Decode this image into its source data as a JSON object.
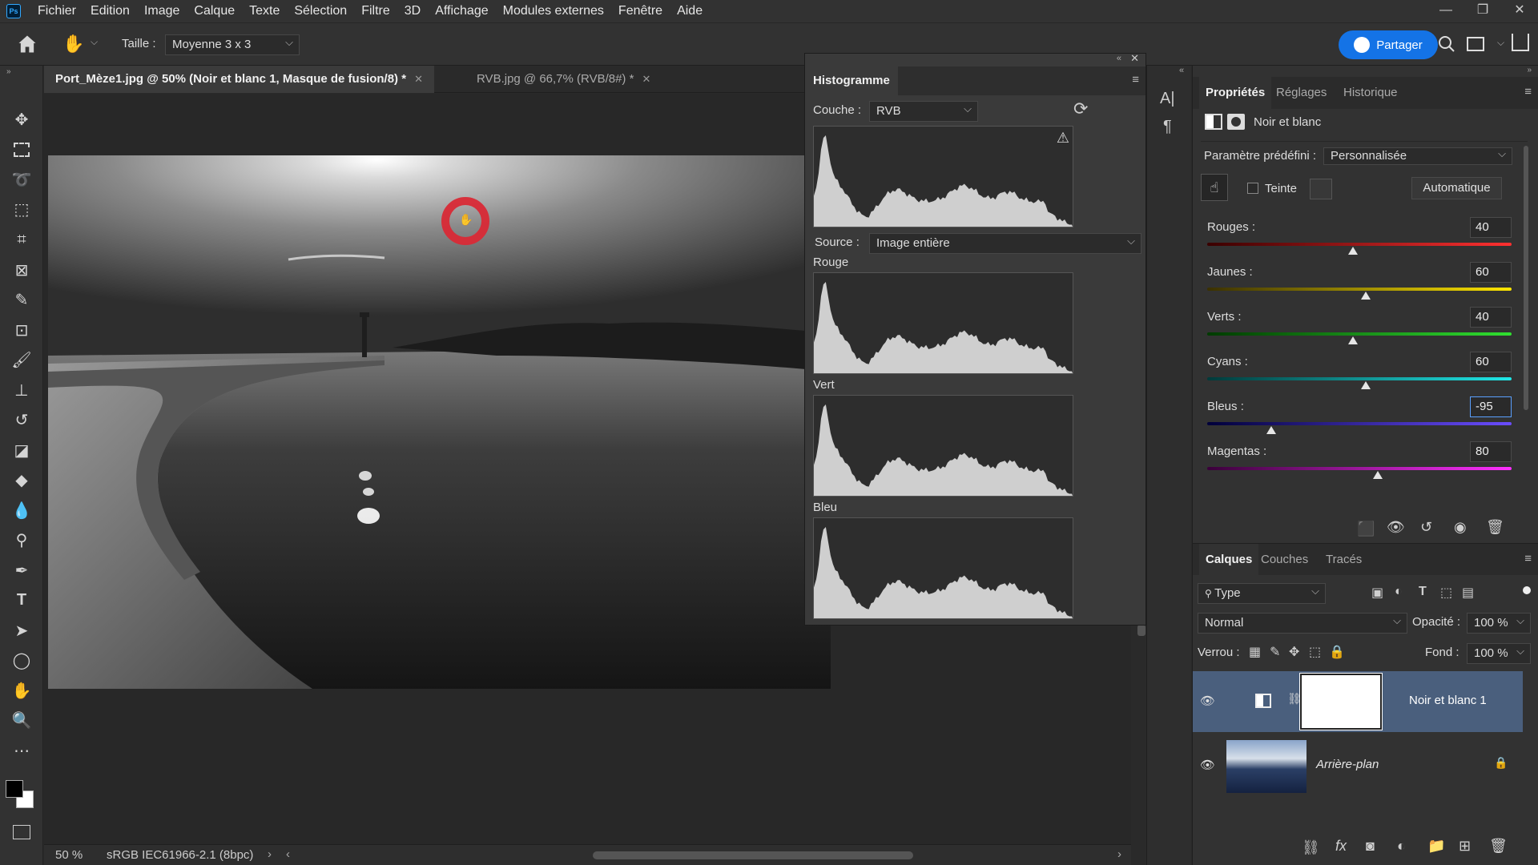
{
  "menubar": {
    "logo": "Ps",
    "items": [
      "Fichier",
      "Edition",
      "Image",
      "Calque",
      "Texte",
      "Sélection",
      "Filtre",
      "3D",
      "Affichage",
      "Modules externes",
      "Fenêtre",
      "Aide"
    ]
  },
  "options": {
    "size_label": "Taille :",
    "size_value": "Moyenne 3 x 3",
    "share_label": "Partager"
  },
  "tabs": [
    {
      "label": "Port_Mèze1.jpg @ 50% (Noir et blanc 1, Masque de fusion/8) *"
    },
    {
      "label": "RVB.jpg @ 66,7% (RVB/8#) *"
    }
  ],
  "status": {
    "zoom": "50 %",
    "profile": "sRGB IEC61966-2.1 (8bpc)"
  },
  "histogram": {
    "title": "Histogramme",
    "channel_label": "Couche :",
    "channel_value": "RVB",
    "source_label": "Source :",
    "source_value": "Image entière",
    "channels": [
      "Rouge",
      "Vert",
      "Bleu"
    ]
  },
  "properties": {
    "tabs": [
      "Propriétés",
      "Réglages",
      "Historique"
    ],
    "adjustment_name": "Noir et blanc",
    "preset_label": "Paramètre prédéfini :",
    "preset_value": "Personnalisée",
    "tint_label": "Teinte",
    "auto_label": "Automatique",
    "sliders": [
      {
        "label": "Rouges :",
        "value": "40",
        "num": 40
      },
      {
        "label": "Jaunes :",
        "value": "60",
        "num": 60
      },
      {
        "label": "Verts :",
        "value": "40",
        "num": 40
      },
      {
        "label": "Cyans :",
        "value": "60",
        "num": 60
      },
      {
        "label": "Bleus :",
        "value": "-95",
        "num": -95
      },
      {
        "label": "Magentas :",
        "value": "80",
        "num": 80
      }
    ]
  },
  "layers": {
    "tabs": [
      "Calques",
      "Couches",
      "Tracés"
    ],
    "filter_value": "Type",
    "blend_mode": "Normal",
    "opacity_label": "Opacité :",
    "opacity_value": "100 %",
    "lock_label": "Verrou :",
    "fill_label": "Fond :",
    "fill_value": "100 %",
    "items": [
      {
        "name": "Noir et blanc 1"
      },
      {
        "name": "Arrière-plan"
      }
    ]
  }
}
